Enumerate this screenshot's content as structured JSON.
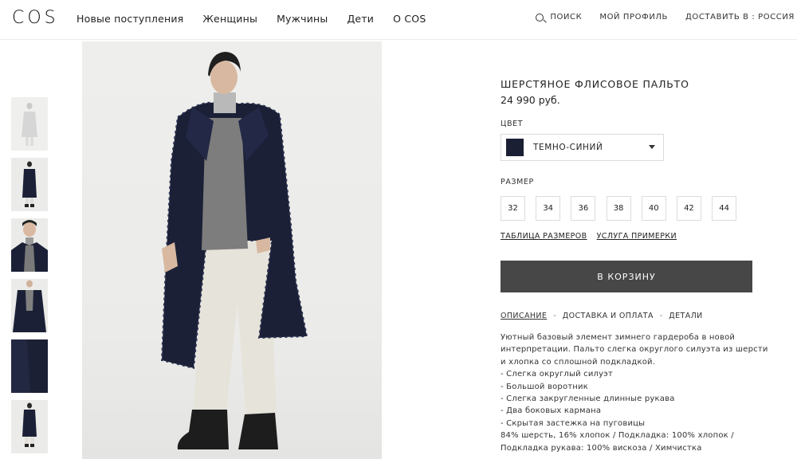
{
  "header": {
    "logo": "COS",
    "nav": [
      "Новые поступления",
      "Женщины",
      "Мужчины",
      "Дети",
      "О COS"
    ],
    "search_label": "ПОИСК",
    "profile_label": "МОЙ ПРОФИЛЬ",
    "deliver_label": "ДОСТАВИТЬ В : РОССИЯ"
  },
  "product": {
    "title": "ШЕРСТЯНОЕ ФЛИСОВОЕ ПАЛЬТО",
    "price": "24 990 руб.",
    "color_label": "ЦВЕТ",
    "color_name": "ТЕМНО-СИНИЙ",
    "color_swatch": "#1a1f33",
    "size_label": "РАЗМЕР",
    "sizes": [
      "32",
      "34",
      "36",
      "38",
      "40",
      "42",
      "44"
    ],
    "size_chart_link": "ТАБЛИЦА РАЗМЕРОВ",
    "fitting_link": "УСЛУГА ПРИМЕРКИ",
    "add_to_cart": "В КОРЗИНУ",
    "tabs": [
      "ОПИСАНИЕ",
      "ДОСТАВКА И ОПЛАТА",
      "ДЕТАЛИ"
    ],
    "description": [
      "Уютный базовый элемент зимнего гардероба в новой",
      "интерпретации. Пальто слегка округлого силуэта из шерсти",
      "и хлопка со сплошной подкладкой.",
      "- Слегка округлый силуэт",
      "- Большой воротник",
      "- Слегка закругленные длинные рукава",
      "- Два боковых кармана",
      "- Скрытая застежка на пуговицы",
      "84% шерсть, 16% хлопок / Подкладка: 100% хлопок /",
      "Подкладка рукава: 100% вискоза / Химчистка"
    ]
  },
  "colors": {
    "button_bg": "#474747",
    "coat": "#1b2036",
    "image_bg": "#ebebe9"
  }
}
